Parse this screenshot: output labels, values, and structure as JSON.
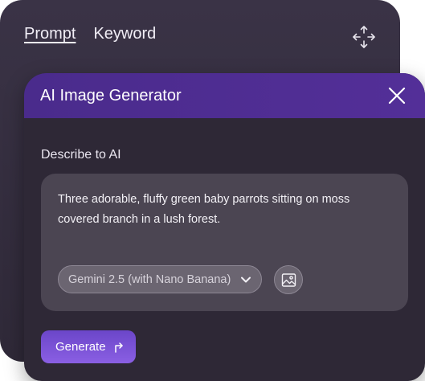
{
  "back_panel": {
    "tabs": [
      {
        "label": "Prompt",
        "active": true
      },
      {
        "label": "Keyword",
        "active": false
      }
    ],
    "move_icon": "move-arrows-icon"
  },
  "dialog": {
    "title": "AI Image Generator",
    "close_icon": "close-icon",
    "describe_label": "Describe to AI",
    "prompt_text": "Three adorable, fluffy green baby parrots sitting on moss covered branch in a lush forest.",
    "model_select": {
      "selected": "Gemini 2.5 (with Nano Banana)",
      "icon": "chevron-down-icon"
    },
    "image_button_icon": "image-icon",
    "generate_label": "Generate",
    "generate_icon": "arrow-turn-up-right-icon"
  },
  "colors": {
    "header_purple": "#4f2d93",
    "button_purple": "#7a52d6",
    "panel_bg": "#2e2836",
    "input_bg": "#4b4552"
  }
}
